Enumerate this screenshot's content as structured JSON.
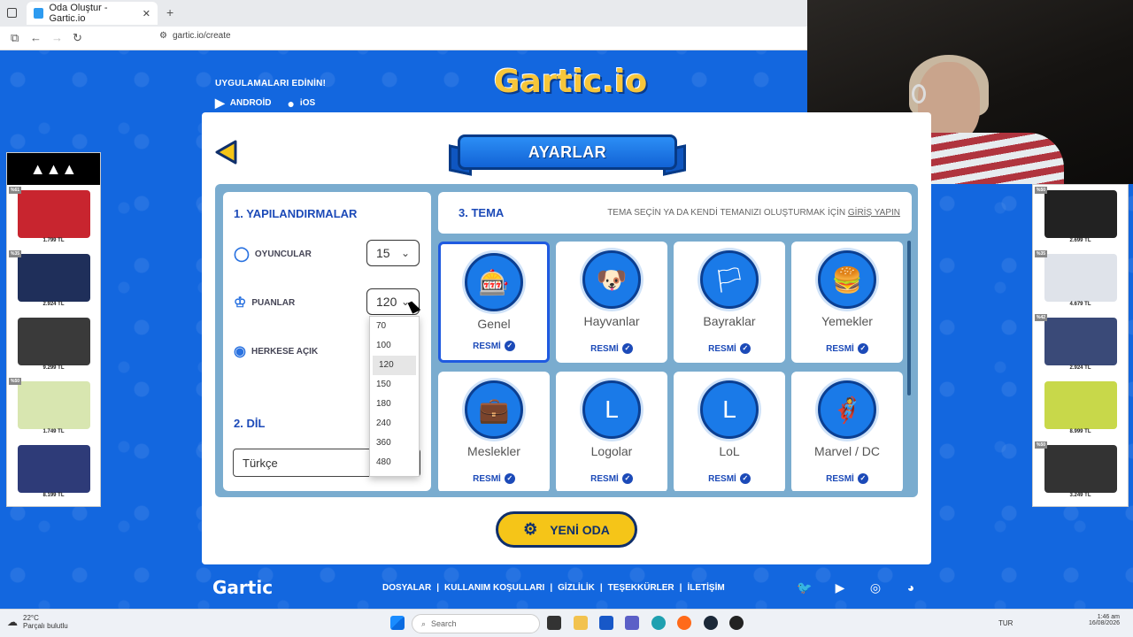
{
  "browser": {
    "tab_title": "Oda Oluştur - Gartic.io",
    "url": "gartic.io/create"
  },
  "apps": {
    "title": "UYGULAMALARI EDİNİN!",
    "android": "ANDROİD",
    "ios": "iOS"
  },
  "logo": "Gartic.io",
  "header": {
    "title": "AYARLAR"
  },
  "config": {
    "section_title": "1. YAPILANDIRMALAR",
    "players_label": "OYUNCULAR",
    "players_value": "15",
    "points_label": "PUANLAR",
    "points_value": "120",
    "public_label": "HERKESE AÇIK",
    "points_options": [
      "70",
      "100",
      "120",
      "150",
      "180",
      "240",
      "360",
      "480"
    ]
  },
  "language": {
    "section_title": "2. DİL",
    "value": "Türkçe"
  },
  "theme": {
    "section_title": "3. TEMA",
    "subtitle_prefix": "TEMA SEÇİN YA DA KENDİ TEMANIZI OLUŞTURMAK İÇİN ",
    "subtitle_link": "GİRİŞ YAPIN",
    "official_label": "RESMİ",
    "cards": [
      {
        "name": "Genel",
        "icon": "slot-machine-icon",
        "glyph": "🎰",
        "selected": true
      },
      {
        "name": "Hayvanlar",
        "icon": "dog-icon",
        "glyph": "🐶",
        "selected": false
      },
      {
        "name": "Bayraklar",
        "icon": "flag-icon",
        "glyph": "🏳",
        "selected": false
      },
      {
        "name": "Yemekler",
        "icon": "burger-icon",
        "glyph": "🍔",
        "selected": false
      },
      {
        "name": "Meslekler",
        "icon": "briefcase-icon",
        "glyph": "💼",
        "selected": false
      },
      {
        "name": "Logolar",
        "icon": "logo-icon",
        "glyph": "L",
        "selected": false
      },
      {
        "name": "LoL",
        "icon": "league-icon",
        "glyph": "L",
        "selected": false
      },
      {
        "name": "Marvel / DC",
        "icon": "hero-mask-icon",
        "glyph": "🦸",
        "selected": false
      }
    ]
  },
  "new_room": "YENİ ODA",
  "footer": {
    "logo": "Gartic",
    "links": [
      "DOSYALAR",
      "|",
      "KULLANIM KOŞULLARI",
      "|",
      "GİZLİLİK",
      "|",
      "TEŞEKKÜRLER",
      "|",
      "İLETİŞİM"
    ]
  },
  "ads_left": [
    {
      "pct": "%61",
      "price": "1.799 TL",
      "color": "#c8252f"
    },
    {
      "pct": "%35",
      "price": "2.924 TL",
      "color": "#1f2f5a"
    },
    {
      "pct": "",
      "price": "9.299 TL",
      "color": "#3a3a3a"
    },
    {
      "pct": "%50",
      "price": "1.749 TL",
      "color": "#d8e6b0"
    },
    {
      "pct": "",
      "price": "8.199 TL",
      "color": "#2e3b78"
    }
  ],
  "ads_right": [
    {
      "pct": "%50",
      "price": "2.699 TL",
      "color": "#222"
    },
    {
      "pct": "%35",
      "price": "4.679 TL",
      "color": "#dfe3ea"
    },
    {
      "pct": "%42",
      "price": "2.924 TL",
      "color": "#3a4a78"
    },
    {
      "pct": "",
      "price": "8.999 TL",
      "color": "#c8d84a"
    },
    {
      "pct": "%50",
      "price": "3.249 TL",
      "color": "#333"
    }
  ],
  "taskbar": {
    "temp": "22°C",
    "weather": "Parçalı bulutlu",
    "search": "Search",
    "lang": "TUR",
    "time": "1:46 am",
    "date": "16/08/2026"
  }
}
